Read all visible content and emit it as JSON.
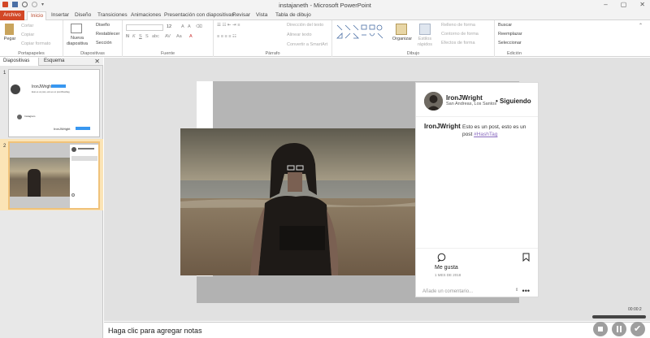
{
  "window": {
    "title": "instajaneth - Microsoft PowerPoint"
  },
  "ribbon_tabs": [
    {
      "label": "Archivo"
    },
    {
      "label": "Inicio"
    },
    {
      "label": "Insertar"
    },
    {
      "label": "Diseño"
    },
    {
      "label": "Transiciones"
    },
    {
      "label": "Animaciones"
    },
    {
      "label": "Presentación con diapositivas"
    },
    {
      "label": "Revisar"
    },
    {
      "label": "Vista"
    },
    {
      "label": "Tabla de dibujo"
    }
  ],
  "ribbon": {
    "clipboard": {
      "paste": "Pegar",
      "cut": "Cortar",
      "copy": "Copiar",
      "format_painter": "Copiar formato",
      "group": "Portapapeles"
    },
    "slides": {
      "new_slide": "Nueva diapositiva",
      "layout": "Diseño",
      "reset": "Restablecer",
      "section": "Sección",
      "group": "Diapositivas"
    },
    "font": {
      "group": "Fuente",
      "size": "12"
    },
    "paragraph": {
      "text_direction": "Dirección del texto",
      "align_text": "Alinear texto",
      "smartart": "Convertir a SmartArt",
      "group": "Párrafo"
    },
    "drawing": {
      "arrange": "Organizar",
      "quick_styles": "Estilos rápidos",
      "shape_fill": "Relleno de forma",
      "shape_outline": "Contorno de forma",
      "shape_effects": "Efectos de forma",
      "group": "Dibujo"
    },
    "editing": {
      "find": "Buscar",
      "replace": "Reemplazar",
      "select": "Seleccionar",
      "group": "Edición"
    }
  },
  "left_pane": {
    "tabs": [
      {
        "label": "Diapositivas"
      },
      {
        "label": "Esquema"
      }
    ],
    "slide_numbers": [
      "1",
      "2"
    ],
    "thumb1": {
      "user": "IronJWright",
      "follow": "Siguiendo",
      "caption": "Esto es un post, esto es un post #hashtag",
      "brand": "Instagram"
    }
  },
  "instagram": {
    "username": "IronJWright",
    "follow_label": "• Siguiendo",
    "location": "San Andreas, Los Santos",
    "caption_user": "IronJWright",
    "caption_text": "Esto es un post, esto es un post",
    "hashtag": "#HashTag",
    "likes_label": "Me gusta",
    "date_label": "1 MES DE 2018",
    "comment_placeholder": "Añade un comentario...",
    "more_label": "•••"
  },
  "notes": {
    "placeholder": "Haga clic para agregar notas"
  },
  "recorder": {
    "time": "00:00:2"
  },
  "colors": {
    "accent": "#d24726",
    "hashtag": "#8a6bbf",
    "slide_bg": "#b5b5b5",
    "canvas": "#e1e1e1"
  }
}
